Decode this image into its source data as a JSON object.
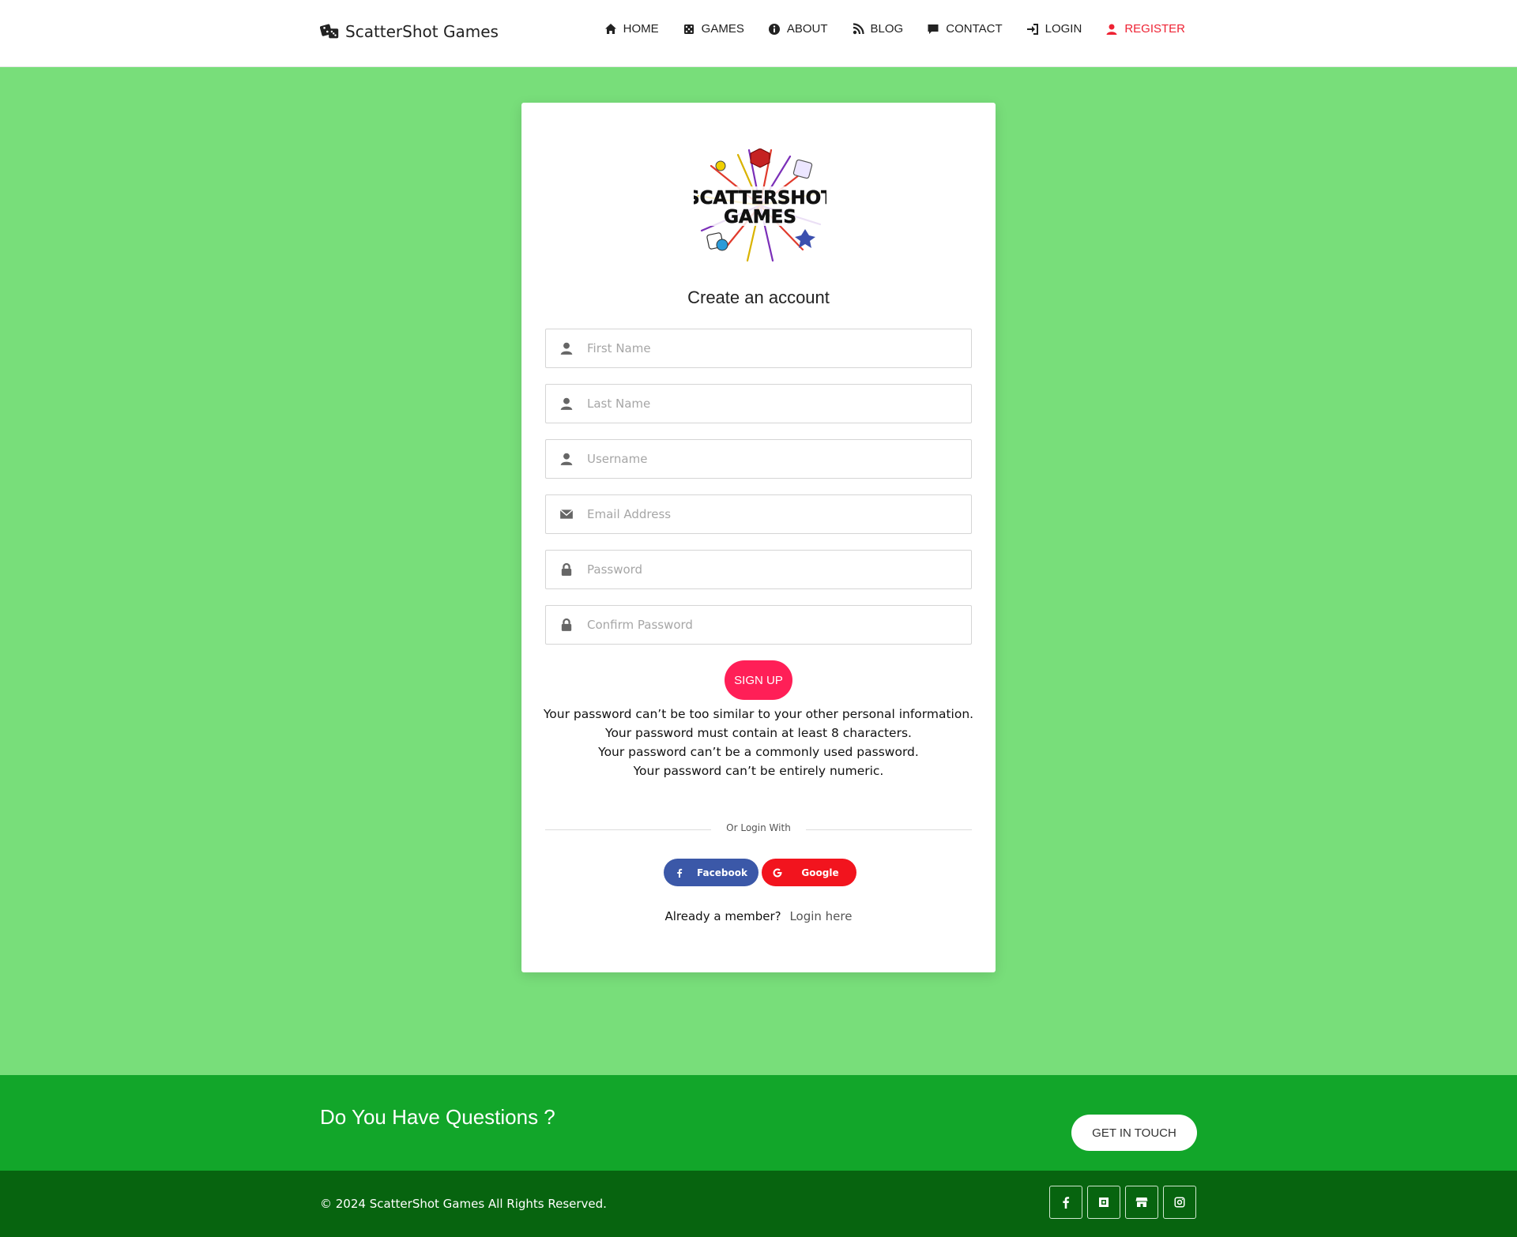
{
  "header": {
    "brand": "ScatterShot Games",
    "nav": [
      {
        "label": "HOME",
        "icon": "home-icon"
      },
      {
        "label": "GAMES",
        "icon": "dice-five-icon"
      },
      {
        "label": "ABOUT",
        "icon": "info-circle-icon"
      },
      {
        "label": "BLOG",
        "icon": "blog-icon"
      },
      {
        "label": "CONTACT",
        "icon": "comment-icon"
      },
      {
        "label": "LOGIN",
        "icon": "sign-in-icon"
      },
      {
        "label": "REGISTER",
        "icon": "user-icon",
        "active": true
      }
    ]
  },
  "card": {
    "logo_text": [
      "SCATTERSHOT",
      "GAMES"
    ],
    "title": "Create an account",
    "fields": [
      {
        "placeholder": "First Name",
        "value": "",
        "icon": "user-icon"
      },
      {
        "placeholder": "Last Name",
        "value": "",
        "icon": "user-icon"
      },
      {
        "placeholder": "Username",
        "value": "",
        "icon": "user-icon"
      },
      {
        "placeholder": "Email Address",
        "value": "",
        "icon": "envelope-icon"
      },
      {
        "placeholder": "Password",
        "value": "",
        "icon": "lock-icon"
      },
      {
        "placeholder": "Confirm Password",
        "value": "",
        "icon": "lock-icon"
      }
    ],
    "signup_label": "SIGN UP",
    "password_help": [
      "Your password can’t be too similar to your other personal information.",
      "Your password must contain at least 8 characters.",
      "Your password can’t be a commonly used password.",
      "Your password can’t be entirely numeric."
    ],
    "divider_text": "Or Login With",
    "facebook_label": "Facebook",
    "google_label": "Google",
    "member_text": "Already a member?",
    "login_link": "Login here"
  },
  "cta": {
    "heading": "Do You Have Questions ?",
    "button": "GET IN TOUCH"
  },
  "footer": {
    "copyright": "© 2024 ScatterShot Games All Rights Reserved.",
    "socials": [
      "facebook-icon",
      "square-icon",
      "store-icon",
      "instagram-icon"
    ]
  },
  "colors": {
    "page_bg": "#78de7a",
    "accent": "#ee2233",
    "signup": "#ff1f57",
    "facebook": "#3b58a8",
    "google": "#f2141e",
    "cta_band": "#12a62a",
    "footer": "#07640f"
  }
}
